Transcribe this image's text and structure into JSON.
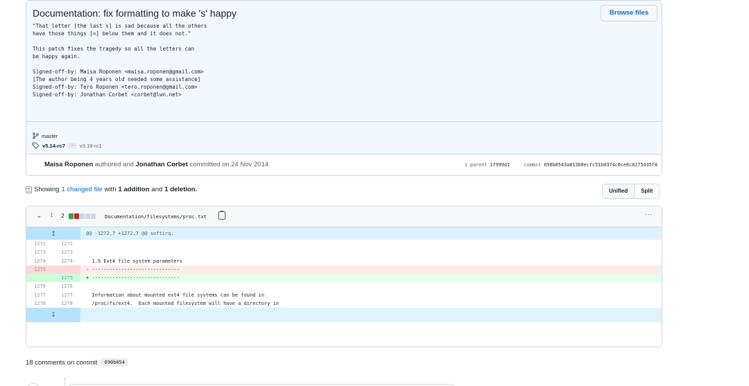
{
  "commit": {
    "title": "Documentation: fix formatting to make 's' happy",
    "browse_label": "Browse files",
    "description": "\"That letter [the last s] is sad because all the others\nhave those things [=] below them and it does not.\"\n\nThis patch fixes the tragedy so all the letters can\nbe happy again.\n\nSigned-off-by: Maisa Roponen <maisa.roponen@gmail.com>\n[The author being 4 years old needed some assistance]\nSigned-off-by: Tero Roponen <tero.roponen@gmail.com>\nSigned-off-by: Jonathan Corbet <corbet@lwn.net>",
    "branch": "master",
    "tag_main": "v5.14-rc7",
    "tag_more": "…",
    "tag_other": "v3.19-rc1",
    "author": "Maisa Roponen",
    "authored_text": "authored and",
    "committer": "Jonathan Corbet",
    "committed_text": "committed on 24 Nov 2014",
    "parent_label": "1 parent",
    "parent_sha": "1f999d1",
    "commit_label": "commit",
    "commit_sha": "690b0543a813b0ecfc51b0374c0ce6c8275435f0"
  },
  "summary": {
    "showing": "Showing",
    "changed_files": "1 changed file",
    "with": "with",
    "additions": "1 addition",
    "and": "and",
    "deletions": "1 deletion."
  },
  "view_toggle": {
    "unified": "Unified",
    "split": "Split"
  },
  "file": {
    "changes": "2",
    "path": "Documentation/filesystems/proc.txt",
    "more": "···",
    "hunk": "@@ -1272,7 +1272,7 @@ softirq.",
    "rows": [
      {
        "type": "ctx",
        "old": "1272",
        "new": "1272",
        "code": ""
      },
      {
        "type": "ctx",
        "old": "1273",
        "new": "1273",
        "code": ""
      },
      {
        "type": "ctx",
        "old": "1274",
        "new": "1274",
        "code": "  1.9 Ext4 file system parameters"
      },
      {
        "type": "del",
        "old": "1275",
        "new": "",
        "code": "- ------------------------------"
      },
      {
        "type": "add",
        "old": "",
        "new": "1275",
        "code": "+ ------------------------------",
        "hl": "-"
      },
      {
        "type": "ctx",
        "old": "1276",
        "new": "1276",
        "code": ""
      },
      {
        "type": "ctx",
        "old": "1277",
        "new": "1277",
        "code": "  Information about mounted ext4 file systems can be found in"
      },
      {
        "type": "ctx",
        "old": "1278",
        "new": "1278",
        "code": "  /proc/fs/ext4.  Each mounted filesystem will have a directory in"
      }
    ]
  },
  "comments": {
    "title": "18 comments on commit",
    "sha": "690b054"
  },
  "colors": {
    "added": "#2da44e",
    "deleted": "#cf222e",
    "neutral": "#d0d7de",
    "link": "#0969da"
  }
}
